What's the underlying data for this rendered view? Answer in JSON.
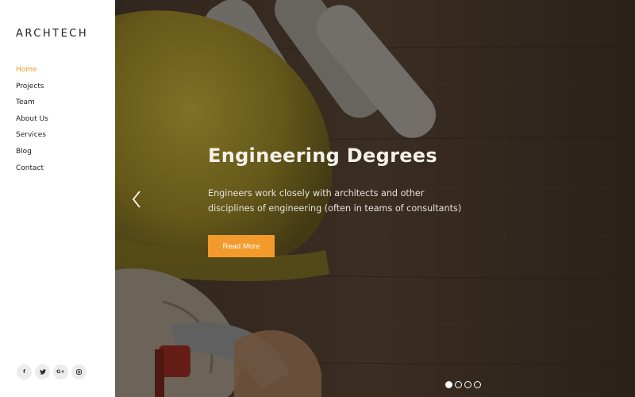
{
  "brand": {
    "logo_text": "ARCHTECH"
  },
  "nav": {
    "items": [
      {
        "label": "Home",
        "active": true
      },
      {
        "label": "Projects",
        "active": false
      },
      {
        "label": "Team",
        "active": false
      },
      {
        "label": "About Us",
        "active": false
      },
      {
        "label": "Services",
        "active": false
      },
      {
        "label": "Blog",
        "active": false
      },
      {
        "label": "Contact",
        "active": false
      }
    ]
  },
  "social": [
    {
      "icon": "facebook-icon",
      "glyph": "f"
    },
    {
      "icon": "twitter-icon",
      "glyph": "♥"
    },
    {
      "icon": "google-plus-icon",
      "glyph": "G+"
    },
    {
      "icon": "instagram-icon",
      "glyph": "◎"
    }
  ],
  "hero": {
    "title": "Engineering Degrees",
    "text_line1": "Engineers work closely with architects and other",
    "text_line2": "disciplines of engineering (often in teams of consultants)",
    "button_label": "Read More",
    "prev_icon": "chevron-left-icon"
  },
  "slider": {
    "total_slides": 4,
    "current_slide": 1
  },
  "colors": {
    "accent": "#f39a2d",
    "text_dark": "#222222",
    "hero_text": "#f5f1ea"
  }
}
